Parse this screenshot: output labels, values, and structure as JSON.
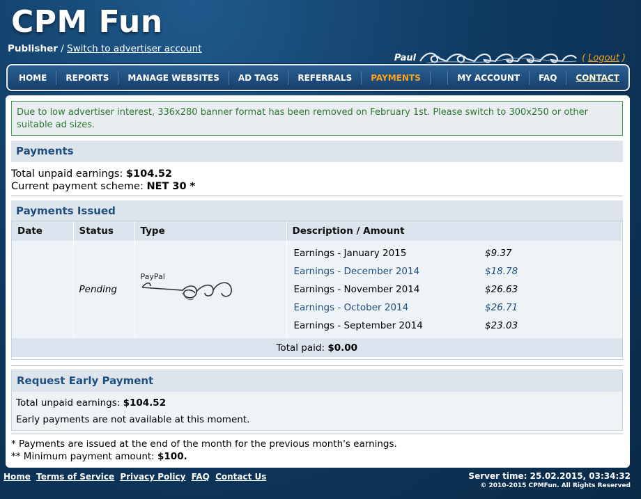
{
  "header": {
    "logo": "CPM Fun",
    "role": "Publisher",
    "separator": "/",
    "switch_link": "Switch to advertiser account",
    "username": "Paul",
    "logout_open": "(",
    "logout": "Logout",
    "logout_close": ")"
  },
  "nav": {
    "items": [
      "HOME",
      "REPORTS",
      "MANAGE WEBSITES",
      "AD TAGS",
      "REFERRALS",
      "PAYMENTS"
    ],
    "right_items": [
      "MY ACCOUNT",
      "FAQ",
      "CONTACT"
    ],
    "active": "PAYMENTS"
  },
  "notice": "Due to low advertiser interest, 336x280 banner format has been removed on February 1st. Please switch to 300x250 or other suitable ad sizes.",
  "payments": {
    "title": "Payments",
    "unpaid_label": "Total unpaid earnings:",
    "unpaid_value": "$104.52",
    "scheme_label": "Current payment scheme:",
    "scheme_value": "NET 30 *"
  },
  "issued": {
    "title": "Payments Issued",
    "columns": [
      "Date",
      "Status",
      "Type",
      "Description / Amount"
    ],
    "status": "Pending",
    "type": "PayPal",
    "rows": [
      {
        "desc": "Earnings - January 2015",
        "amount": "$9.37"
      },
      {
        "desc": "Earnings - December 2014",
        "amount": "$18.78"
      },
      {
        "desc": "Earnings - November 2014",
        "amount": "$26.63"
      },
      {
        "desc": "Earnings - October 2014",
        "amount": "$26.71"
      },
      {
        "desc": "Earnings - September 2014",
        "amount": "$23.03"
      }
    ],
    "total_label": "Total paid:",
    "total_value": "$0.00"
  },
  "early": {
    "title": "Request Early Payment",
    "unpaid_label": "Total unpaid earnings:",
    "unpaid_value": "$104.52",
    "note": "Early payments are not available at this moment."
  },
  "footnotes": {
    "line1": "* Payments are issued at the end of the month for the previous month's earnings.",
    "line2_label": "** Minimum payment amount:",
    "line2_value": "$100."
  },
  "footer": {
    "links": [
      "Home",
      "Terms of Service",
      "Privacy Policy",
      "FAQ",
      "Contact Us"
    ],
    "server_time": "Server time: 25.02.2015, 03:34:32",
    "copyright": "© 2010-2015 CPMFun. All Rights Reserved"
  }
}
